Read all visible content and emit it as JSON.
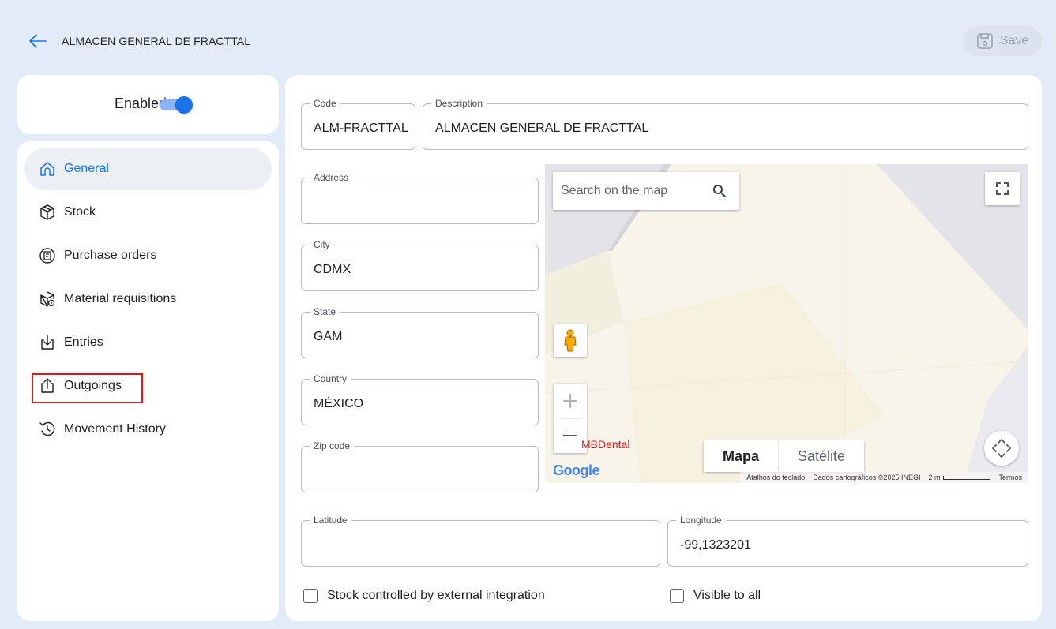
{
  "header": {
    "title": "ALMACEN GENERAL DE FRACTTAL",
    "save_label": "Save"
  },
  "status": {
    "enabled_label": "Enabled",
    "enabled": true
  },
  "sidebar": {
    "items": [
      {
        "label": "General",
        "icon": "home-icon",
        "active": true
      },
      {
        "label": "Stock",
        "icon": "box-icon",
        "active": false
      },
      {
        "label": "Purchase orders",
        "icon": "receipt-icon",
        "active": false
      },
      {
        "label": "Material requisitions",
        "icon": "box-settings-icon",
        "active": false
      },
      {
        "label": "Entries",
        "icon": "download-icon",
        "active": false
      },
      {
        "label": "Outgoings",
        "icon": "upload-icon",
        "active": false
      },
      {
        "label": "Movement History",
        "icon": "history-icon",
        "active": false
      }
    ]
  },
  "form": {
    "code": {
      "label": "Code",
      "value": "ALM-FRACTTAL"
    },
    "description": {
      "label": "Description",
      "value": "ALMACEN GENERAL DE FRACTTAL"
    },
    "address": {
      "label": "Address",
      "value": ""
    },
    "city": {
      "label": "City",
      "value": "CDMX"
    },
    "state": {
      "label": "State",
      "value": "GAM"
    },
    "country": {
      "label": "Country",
      "value": "MÉXICO"
    },
    "zip": {
      "label": "Zip code",
      "value": ""
    },
    "latitude": {
      "label": "Latitude",
      "value": ""
    },
    "longitude": {
      "label": "Longitude",
      "value": "-99,1323201"
    }
  },
  "map": {
    "search_placeholder": "Search on the map",
    "poi_label": "MBDental",
    "type_map": "Mapa",
    "type_satellite": "Satélite",
    "google": "Google",
    "footer_shortcuts": "Atalhos do teclado",
    "footer_data": "Dados cartográficos ©2025 INEGI",
    "footer_scale": "2 m",
    "footer_terms": "Termos"
  },
  "options": {
    "external_integration_label": "Stock controlled by external integration",
    "external_integration_checked": false,
    "visible_all_label": "Visible to all",
    "visible_all_checked": false
  },
  "colors": {
    "accent": "#1a73e8",
    "background": "#e3ebf8",
    "highlight": "#e0191e"
  }
}
